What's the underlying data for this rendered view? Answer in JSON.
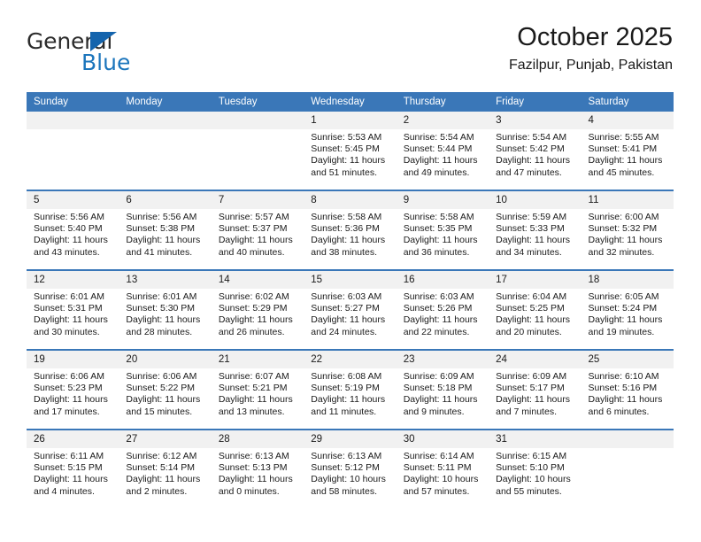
{
  "brand": {
    "name_part1": "General",
    "name_part2": "Blue",
    "accent_color": "#1b75bc",
    "triangle_color": "#1464ad"
  },
  "header": {
    "title": "October 2025",
    "subtitle": "Fazilpur, Punjab, Pakistan"
  },
  "calendar": {
    "header_bg": "#3a77b8",
    "daynum_bg": "#f1f1f1",
    "weekdays": [
      "Sunday",
      "Monday",
      "Tuesday",
      "Wednesday",
      "Thursday",
      "Friday",
      "Saturday"
    ],
    "weeks": [
      [
        {
          "day": "",
          "sunrise": "",
          "sunset": "",
          "daylight": "",
          "daylight2": ""
        },
        {
          "day": "",
          "sunrise": "",
          "sunset": "",
          "daylight": "",
          "daylight2": ""
        },
        {
          "day": "",
          "sunrise": "",
          "sunset": "",
          "daylight": "",
          "daylight2": ""
        },
        {
          "day": "1",
          "sunrise": "Sunrise: 5:53 AM",
          "sunset": "Sunset: 5:45 PM",
          "daylight": "Daylight: 11 hours",
          "daylight2": "and 51 minutes."
        },
        {
          "day": "2",
          "sunrise": "Sunrise: 5:54 AM",
          "sunset": "Sunset: 5:44 PM",
          "daylight": "Daylight: 11 hours",
          "daylight2": "and 49 minutes."
        },
        {
          "day": "3",
          "sunrise": "Sunrise: 5:54 AM",
          "sunset": "Sunset: 5:42 PM",
          "daylight": "Daylight: 11 hours",
          "daylight2": "and 47 minutes."
        },
        {
          "day": "4",
          "sunrise": "Sunrise: 5:55 AM",
          "sunset": "Sunset: 5:41 PM",
          "daylight": "Daylight: 11 hours",
          "daylight2": "and 45 minutes."
        }
      ],
      [
        {
          "day": "5",
          "sunrise": "Sunrise: 5:56 AM",
          "sunset": "Sunset: 5:40 PM",
          "daylight": "Daylight: 11 hours",
          "daylight2": "and 43 minutes."
        },
        {
          "day": "6",
          "sunrise": "Sunrise: 5:56 AM",
          "sunset": "Sunset: 5:38 PM",
          "daylight": "Daylight: 11 hours",
          "daylight2": "and 41 minutes."
        },
        {
          "day": "7",
          "sunrise": "Sunrise: 5:57 AM",
          "sunset": "Sunset: 5:37 PM",
          "daylight": "Daylight: 11 hours",
          "daylight2": "and 40 minutes."
        },
        {
          "day": "8",
          "sunrise": "Sunrise: 5:58 AM",
          "sunset": "Sunset: 5:36 PM",
          "daylight": "Daylight: 11 hours",
          "daylight2": "and 38 minutes."
        },
        {
          "day": "9",
          "sunrise": "Sunrise: 5:58 AM",
          "sunset": "Sunset: 5:35 PM",
          "daylight": "Daylight: 11 hours",
          "daylight2": "and 36 minutes."
        },
        {
          "day": "10",
          "sunrise": "Sunrise: 5:59 AM",
          "sunset": "Sunset: 5:33 PM",
          "daylight": "Daylight: 11 hours",
          "daylight2": "and 34 minutes."
        },
        {
          "day": "11",
          "sunrise": "Sunrise: 6:00 AM",
          "sunset": "Sunset: 5:32 PM",
          "daylight": "Daylight: 11 hours",
          "daylight2": "and 32 minutes."
        }
      ],
      [
        {
          "day": "12",
          "sunrise": "Sunrise: 6:01 AM",
          "sunset": "Sunset: 5:31 PM",
          "daylight": "Daylight: 11 hours",
          "daylight2": "and 30 minutes."
        },
        {
          "day": "13",
          "sunrise": "Sunrise: 6:01 AM",
          "sunset": "Sunset: 5:30 PM",
          "daylight": "Daylight: 11 hours",
          "daylight2": "and 28 minutes."
        },
        {
          "day": "14",
          "sunrise": "Sunrise: 6:02 AM",
          "sunset": "Sunset: 5:29 PM",
          "daylight": "Daylight: 11 hours",
          "daylight2": "and 26 minutes."
        },
        {
          "day": "15",
          "sunrise": "Sunrise: 6:03 AM",
          "sunset": "Sunset: 5:27 PM",
          "daylight": "Daylight: 11 hours",
          "daylight2": "and 24 minutes."
        },
        {
          "day": "16",
          "sunrise": "Sunrise: 6:03 AM",
          "sunset": "Sunset: 5:26 PM",
          "daylight": "Daylight: 11 hours",
          "daylight2": "and 22 minutes."
        },
        {
          "day": "17",
          "sunrise": "Sunrise: 6:04 AM",
          "sunset": "Sunset: 5:25 PM",
          "daylight": "Daylight: 11 hours",
          "daylight2": "and 20 minutes."
        },
        {
          "day": "18",
          "sunrise": "Sunrise: 6:05 AM",
          "sunset": "Sunset: 5:24 PM",
          "daylight": "Daylight: 11 hours",
          "daylight2": "and 19 minutes."
        }
      ],
      [
        {
          "day": "19",
          "sunrise": "Sunrise: 6:06 AM",
          "sunset": "Sunset: 5:23 PM",
          "daylight": "Daylight: 11 hours",
          "daylight2": "and 17 minutes."
        },
        {
          "day": "20",
          "sunrise": "Sunrise: 6:06 AM",
          "sunset": "Sunset: 5:22 PM",
          "daylight": "Daylight: 11 hours",
          "daylight2": "and 15 minutes."
        },
        {
          "day": "21",
          "sunrise": "Sunrise: 6:07 AM",
          "sunset": "Sunset: 5:21 PM",
          "daylight": "Daylight: 11 hours",
          "daylight2": "and 13 minutes."
        },
        {
          "day": "22",
          "sunrise": "Sunrise: 6:08 AM",
          "sunset": "Sunset: 5:19 PM",
          "daylight": "Daylight: 11 hours",
          "daylight2": "and 11 minutes."
        },
        {
          "day": "23",
          "sunrise": "Sunrise: 6:09 AM",
          "sunset": "Sunset: 5:18 PM",
          "daylight": "Daylight: 11 hours",
          "daylight2": "and 9 minutes."
        },
        {
          "day": "24",
          "sunrise": "Sunrise: 6:09 AM",
          "sunset": "Sunset: 5:17 PM",
          "daylight": "Daylight: 11 hours",
          "daylight2": "and 7 minutes."
        },
        {
          "day": "25",
          "sunrise": "Sunrise: 6:10 AM",
          "sunset": "Sunset: 5:16 PM",
          "daylight": "Daylight: 11 hours",
          "daylight2": "and 6 minutes."
        }
      ],
      [
        {
          "day": "26",
          "sunrise": "Sunrise: 6:11 AM",
          "sunset": "Sunset: 5:15 PM",
          "daylight": "Daylight: 11 hours",
          "daylight2": "and 4 minutes."
        },
        {
          "day": "27",
          "sunrise": "Sunrise: 6:12 AM",
          "sunset": "Sunset: 5:14 PM",
          "daylight": "Daylight: 11 hours",
          "daylight2": "and 2 minutes."
        },
        {
          "day": "28",
          "sunrise": "Sunrise: 6:13 AM",
          "sunset": "Sunset: 5:13 PM",
          "daylight": "Daylight: 11 hours",
          "daylight2": "and 0 minutes."
        },
        {
          "day": "29",
          "sunrise": "Sunrise: 6:13 AM",
          "sunset": "Sunset: 5:12 PM",
          "daylight": "Daylight: 10 hours",
          "daylight2": "and 58 minutes."
        },
        {
          "day": "30",
          "sunrise": "Sunrise: 6:14 AM",
          "sunset": "Sunset: 5:11 PM",
          "daylight": "Daylight: 10 hours",
          "daylight2": "and 57 minutes."
        },
        {
          "day": "31",
          "sunrise": "Sunrise: 6:15 AM",
          "sunset": "Sunset: 5:10 PM",
          "daylight": "Daylight: 10 hours",
          "daylight2": "and 55 minutes."
        },
        {
          "day": "",
          "sunrise": "",
          "sunset": "",
          "daylight": "",
          "daylight2": ""
        }
      ]
    ]
  }
}
